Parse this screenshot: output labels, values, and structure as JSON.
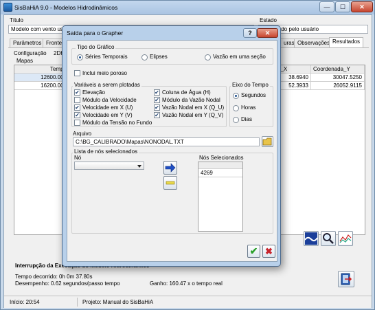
{
  "app": {
    "title": "SisBaHiA 9.0 - Modelos Hidrodinâmicos",
    "window_buttons": {
      "minimize": "—",
      "maximize": "☐",
      "close": "✕"
    }
  },
  "main": {
    "titulo_label": "Título",
    "titulo_value": "Modelo com vento usual + batimetria et al",
    "estado_label": "Estado",
    "estado_value": "Cancelado pelo usuário",
    "tabs": [
      "Parâmetros",
      "Fronteiras",
      "uras",
      "Observações",
      "Resultados"
    ],
    "subtabs": [
      "Configuração",
      "2DH"
    ],
    "mapas_label": "Mapas",
    "grid": {
      "headers": [
        "Tempo",
        "a_X",
        "Coordenada_Y"
      ],
      "rows": [
        [
          "12600.000",
          "38.6940",
          "30047.5250"
        ],
        [
          "16200.000",
          "52.3933",
          "26052.9115"
        ]
      ]
    },
    "progress_title": "Interrupção da Execução do Modelo Hidrodinâmico",
    "tempo_decorrido": "Tempo decorrido:  0h  0m 37.80s",
    "desempenho": "Desempenho: 0.62 segundos/passo tempo",
    "ganho": "Ganho: 160.47 x o tempo real",
    "status_inicio": "Início: 20:54",
    "status_projeto": "Projeto: Manual do SisBaHiA"
  },
  "dialog": {
    "title": "Saída para o Grapher",
    "help": "?",
    "close": "✕",
    "tipo_grafico": {
      "title": "Tipo do Gráfico",
      "options": [
        "Séries Temporais",
        "Elipses",
        "Vazão em uma seção"
      ],
      "selected": "Séries Temporais"
    },
    "incluir_meio_poroso": "Inclui meio poroso",
    "variaveis": {
      "title": "Variáveis a serem plotadas",
      "col1": [
        {
          "label": "Elevação",
          "checked": true
        },
        {
          "label": "Módulo da Velocidade",
          "checked": false
        },
        {
          "label": "Velocidade em X (U)",
          "checked": true
        },
        {
          "label": "Velocidade em Y (V)",
          "checked": true
        },
        {
          "label": "Módulo da Tensão no Fundo",
          "checked": false
        }
      ],
      "col2": [
        {
          "label": "Coluna de Água (H)",
          "checked": true
        },
        {
          "label": "Módulo da Vazão Nodal",
          "checked": true
        },
        {
          "label": "Vazão Nodal em X (Q_U)",
          "checked": true
        },
        {
          "label": "Vazão Nodal em Y (Q_V)",
          "checked": true
        }
      ]
    },
    "eixo_tempo": {
      "title": "Eixo do Tempo",
      "options": [
        "Segundos",
        "Horas",
        "Dias"
      ],
      "selected": "Segundos"
    },
    "arquivo_label": "Arquivo",
    "arquivo_value": "C:\\BG_CALIBRADO\\Mapas\\NONODAL.TXT",
    "lista_nos_title": "Lista de nós selecionados",
    "no_label": "Nó",
    "nos_selecionados_label": "Nós Selecionados",
    "nos_selecionados": [
      "4269"
    ],
    "check_mark": "✓",
    "x_mark": "X",
    "check_glyph": "✔",
    "ok_glyph": "✔",
    "cancel_glyph": "✖"
  },
  "colors": {
    "titlebar": "#b4cde8",
    "ok_green": "#2aa02a",
    "cancel_red": "#c8242c",
    "arrow_blue": "#1f4fc4",
    "minus_yellow": "#e8d84a"
  }
}
